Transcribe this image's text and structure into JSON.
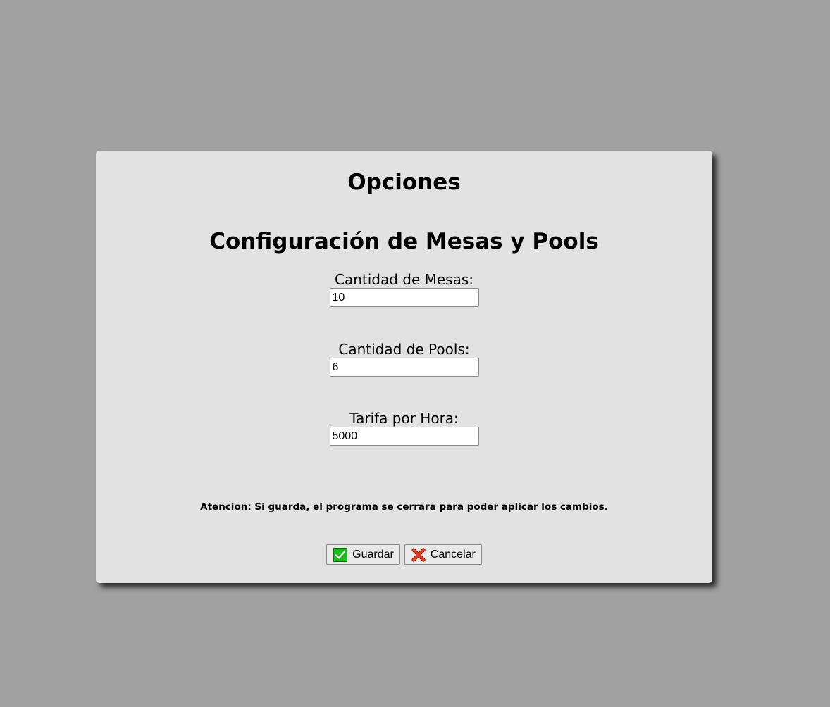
{
  "dialog": {
    "title": "Opciones",
    "subtitle": "Configuración de Mesas y Pools",
    "fields": [
      {
        "label": "Cantidad de Mesas:",
        "value": "10"
      },
      {
        "label": "Cantidad de Pools:",
        "value": "6"
      },
      {
        "label": "Tarifa por Hora:",
        "value": "5000"
      }
    ],
    "warning": "Atencion: Si guarda, el programa se cerrara para poder aplicar los cambios.",
    "buttons": {
      "save_label": "Guardar",
      "save_icon": "check-icon",
      "cancel_label": "Cancelar",
      "cancel_icon": "close-icon"
    }
  },
  "colors": {
    "background": "#a1a1a1",
    "dialog": "#e2e2e2",
    "check_green": "#1db81d",
    "cancel_red": "#e03c1f"
  }
}
